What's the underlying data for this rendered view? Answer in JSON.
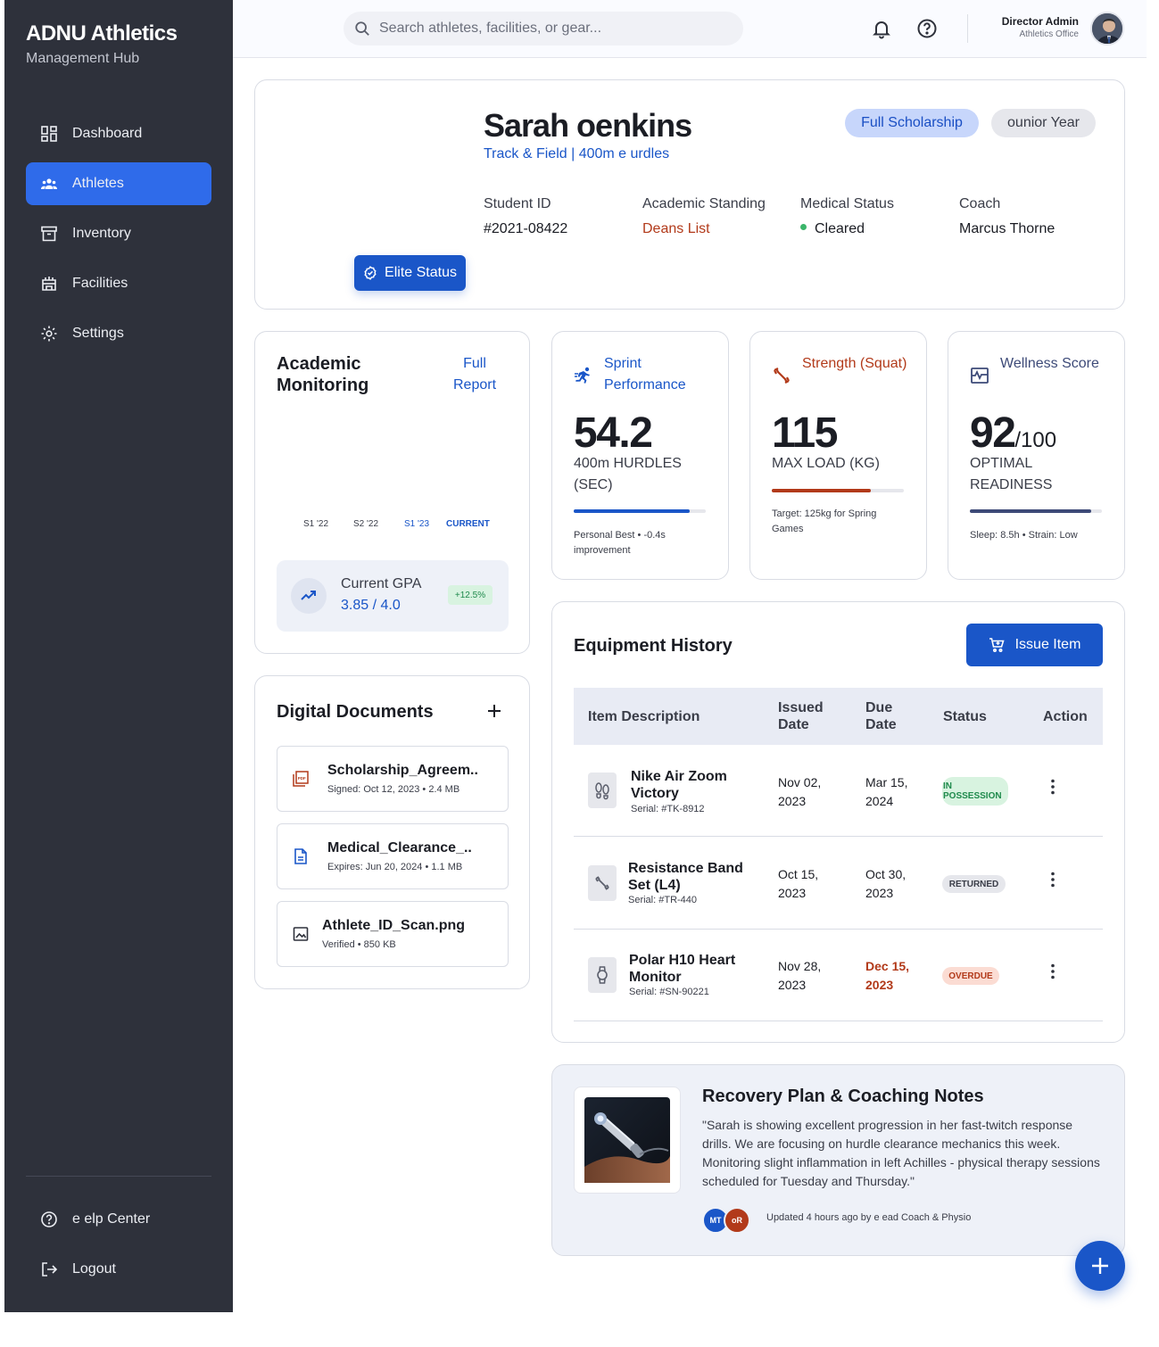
{
  "sidebar": {
    "brand_title": "ADNU Athletics",
    "brand_subtitle": "Management Hub",
    "items": [
      {
        "label": "Dashboard",
        "icon": "dashboard-icon"
      },
      {
        "label": "Athletes",
        "icon": "athletes-icon",
        "active": true
      },
      {
        "label": "Inventory",
        "icon": "inventory-icon"
      },
      {
        "label": "Facilities",
        "icon": "facilities-icon"
      },
      {
        "label": "Settings",
        "icon": "gear-icon"
      }
    ],
    "footer": [
      {
        "label": "e elp Center",
        "icon": "help-icon"
      },
      {
        "label": "Logout",
        "icon": "logout-icon"
      }
    ]
  },
  "header": {
    "search_placeholder": "Search athletes, facilities, or gear...",
    "user_name": "Director Admin",
    "user_role": "Athletics Office"
  },
  "profile": {
    "name": "Sarah oenkins",
    "sport": "Track & Field | 400m e urdles",
    "badges": [
      "Full Scholarship",
      "ounior Year"
    ],
    "elite_label": "Elite Status",
    "info": [
      {
        "label": "Student ID",
        "value": "#2021-08422"
      },
      {
        "label": "Academic Standing",
        "value": "Deans List"
      },
      {
        "label": "Medical Status",
        "value": "Cleared"
      },
      {
        "label": "Coach",
        "value": "Marcus Thorne"
      }
    ]
  },
  "academic": {
    "title": "Academic Monitoring",
    "link": "Full Report",
    "semesters": [
      "S1 '22",
      "S2 '22",
      "S1 '23",
      "CURRENT"
    ],
    "gpa_label": "Current GPA",
    "gpa_value": "3.85 / 4.0",
    "gpa_change": "+12.5%"
  },
  "stats": [
    {
      "title": "Sprint Performance",
      "value": "54.2",
      "suffix": "",
      "unit": "400m HURDLES (SEC)",
      "progress": 0.88,
      "color": "#1a56c8",
      "footer": "Personal Best • -0.4s improvement",
      "icon": "sprint-icon"
    },
    {
      "title": "Strength (Squat)",
      "value": "115",
      "suffix": "",
      "unit": "MAX LOAD (KG)",
      "progress": 0.75,
      "color": "#b23a1a",
      "footer": "Target: 125kg for Spring Games",
      "icon": "dumbbell-icon"
    },
    {
      "title": "Wellness Score",
      "value": "92",
      "suffix": "/100",
      "unit": "OPTIMAL READINESS",
      "progress": 0.92,
      "color": "#3d4a78",
      "footer": "Sleep: 8.5h • Strain: Low",
      "icon": "wellness-icon"
    }
  ],
  "documents": {
    "title": "Digital Documents",
    "items": [
      {
        "name": "Scholarship_Agreem..",
        "meta": "Signed: Oct 12, 2023 • 2.4 MB",
        "icon": "pdf-icon"
      },
      {
        "name": "Medical_Clearance_..",
        "meta": "Expires: Jun 20, 2024 • 1.1 MB",
        "icon": "document-icon"
      },
      {
        "name": "Athlete_ID_Scan.png",
        "meta": "Verified • 850 KB",
        "icon": "image-icon"
      }
    ]
  },
  "equipment": {
    "title": "Equipment History",
    "issue_label": "Issue Item",
    "columns": [
      "Item Description",
      "Issued Date",
      "Due Date",
      "Status",
      "Action"
    ],
    "rows": [
      {
        "name": "Nike Air Zoom Victory",
        "serial": "Serial: #TK-8912",
        "issued": "Nov 02, 2023",
        "due": "Mar 15, 2024",
        "status": "IN POSSESSION",
        "status_type": "green",
        "icon": "footprints-icon"
      },
      {
        "name": "Resistance Band Set (L4)",
        "serial": "Serial: #TR-440",
        "issued": "Oct 15, 2023",
        "due": "Oct 30, 2023",
        "status": "RETURNED",
        "status_type": "gray",
        "icon": "band-icon"
      },
      {
        "name": "Polar H10 Heart Monitor",
        "serial": "Serial: #SN-90221",
        "issued": "Nov 28, 2023",
        "due": "Dec 15, 2023",
        "status": "OVERDUE",
        "status_type": "red",
        "icon": "watch-icon"
      }
    ]
  },
  "notes": {
    "title": "Recovery Plan & Coaching Notes",
    "body": "\"Sarah is showing excellent progression in her fast-twitch response drills. We are focusing on hurdle clearance mechanics this week. Monitoring slight inflammation in left Achilles - physical therapy sessions scheduled for Tuesday and Thursday.\"",
    "avatars": [
      "MT",
      "oR"
    ],
    "meta": "Updated 4 hours ago by e ead Coach & Physio"
  },
  "colors": {
    "sidebar_bg": "#2e313b",
    "accent": "#1a56c8",
    "active_nav": "#2f6bea"
  }
}
